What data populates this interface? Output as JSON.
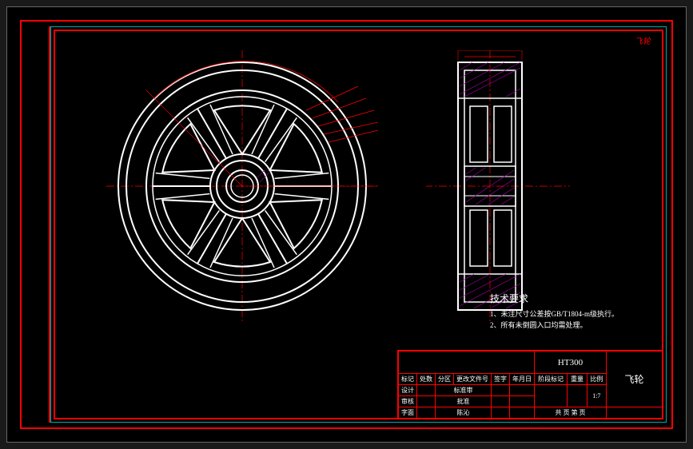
{
  "watermark": "飞轮",
  "tech_requirements": {
    "title": "技术要求",
    "line1": "1、未注尺寸公差按GB/T1804-m级执行。",
    "line2": "2、所有未倒圆入口均需处理。"
  },
  "title_block": {
    "material": "HT300",
    "part_name": "飞轮",
    "headers": {
      "mark": "标记",
      "zone": "处数",
      "division": "分区",
      "change": "更改文件号",
      "sign1": "签字",
      "date1": "年月日",
      "design": "设计",
      "designer": "标准审",
      "approve": "审核",
      "approver": "批准",
      "stage": "阶段标记",
      "weight": "重量",
      "scale": "比例",
      "scale_val": "1:7",
      "sheet": "共  页  第  页",
      "lit1": "字面",
      "lit2": " ",
      "lit3": "陈沁"
    }
  },
  "dimensions": {
    "angle_arc": "",
    "dim_top": "",
    "radial_dims": [
      "",
      "",
      "",
      ""
    ],
    "side_top": "",
    "center_dim": ""
  }
}
